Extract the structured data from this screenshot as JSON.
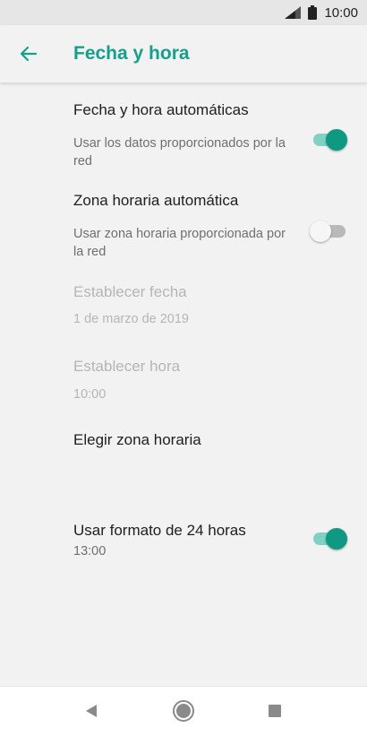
{
  "status_bar": {
    "time": "10:00",
    "icons": [
      "signal-icon",
      "battery-icon"
    ]
  },
  "app_bar": {
    "title": "Fecha y hora",
    "back_icon": "arrow-left-icon"
  },
  "settings": [
    {
      "title": "Fecha y hora automáticas",
      "subtitle": "Usar los datos proporcionados por la red",
      "switch": true,
      "enabled": true
    },
    {
      "title": "Zona horaria automática",
      "subtitle": "Usar zona horaria proporcionada por la red",
      "switch": false,
      "enabled": true
    },
    {
      "title": "Establecer fecha",
      "subtitle": "1 de marzo de 2019",
      "enabled": false
    },
    {
      "title": "Establecer hora",
      "subtitle": "10:00",
      "enabled": false
    },
    {
      "title": "Elegir zona horaria",
      "subtitle": "",
      "enabled": true
    },
    {
      "title": "Usar formato de 24 horas",
      "subtitle": "13:00",
      "switch": true,
      "enabled": true
    }
  ],
  "nav_bar": {
    "buttons": [
      "back-triangle-icon",
      "home-circle-icon",
      "recents-square-icon"
    ]
  },
  "colors": {
    "accent": "#12a18a",
    "switch_on": "#0e9a82",
    "switch_track_on": "#7fd2c2",
    "disabled_text": "#b5b5b5"
  }
}
